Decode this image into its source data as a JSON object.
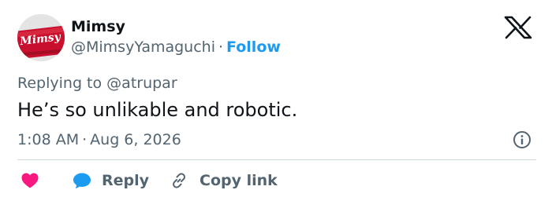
{
  "author": {
    "display_name": "Mimsy",
    "handle": "@MimsyYamaguchi",
    "separator": "·",
    "follow_label": "Follow",
    "avatar_logo_text": "Mimsy"
  },
  "brand": {
    "logo_icon": "x-logo-icon"
  },
  "replying": {
    "prefix": "Replying to",
    "mention": "@atrupar"
  },
  "tweet": {
    "text": "He’s so unlikable and robotic.",
    "time": "1:08 AM",
    "separator": "·",
    "date": "Aug 6, 2026"
  },
  "actions": {
    "like_icon": "heart-icon",
    "reply_icon": "bubble-icon",
    "reply_label": "Reply",
    "copy_icon": "link-icon",
    "copy_label": "Copy link"
  },
  "colors": {
    "accent": "#1d9bf0",
    "like": "#f91880",
    "secondary_text": "#536471",
    "primary_text": "#0f1419",
    "divider": "#cfd9de"
  }
}
